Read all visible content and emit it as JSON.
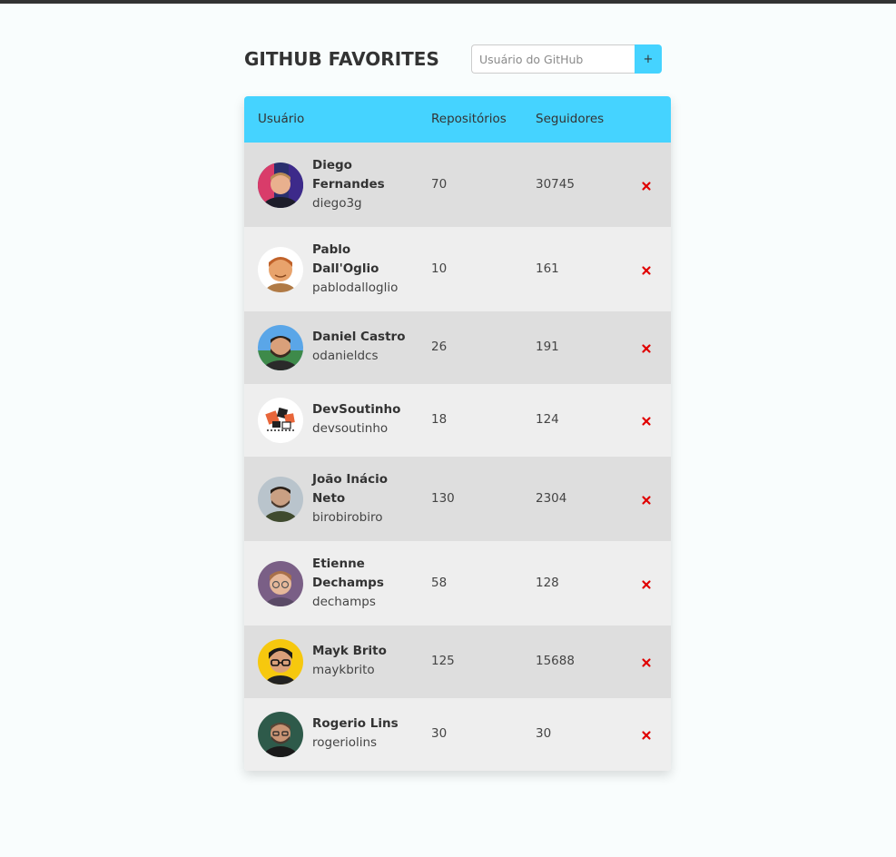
{
  "app": {
    "title": "GITHUB FAVORITES"
  },
  "search": {
    "placeholder": "Usuário do GitHub",
    "value": "",
    "add_label": "+"
  },
  "table": {
    "columns": {
      "user": "Usuário",
      "repos": "Repositórios",
      "followers": "Seguidores"
    },
    "rows": [
      {
        "name": "Diego Fernandes",
        "login": "diego3g",
        "repos": "70",
        "followers": "30745"
      },
      {
        "name": "Pablo Dall'Oglio",
        "login": "pablodalloglio",
        "repos": "10",
        "followers": "161"
      },
      {
        "name": "Daniel Castro",
        "login": "odanieldcs",
        "repos": "26",
        "followers": "191"
      },
      {
        "name": "DevSoutinho",
        "login": "devsoutinho",
        "repos": "18",
        "followers": "124"
      },
      {
        "name": "João Inácio Neto",
        "login": "birobirobiro",
        "repos": "130",
        "followers": "2304"
      },
      {
        "name": "Etienne Dechamps",
        "login": "dechamps",
        "repos": "58",
        "followers": "128"
      },
      {
        "name": "Mayk Brito",
        "login": "maykbrito",
        "repos": "125",
        "followers": "15688"
      },
      {
        "name": "Rogerio Lins",
        "login": "rogeriolins",
        "repos": "30",
        "followers": "30"
      }
    ]
  },
  "icons": {
    "add": "plus-icon",
    "remove": "close-icon",
    "avatar": "user-avatar"
  },
  "colors": {
    "accent": "#45d3ff",
    "remove": "#e00000",
    "row_dark": "#dedede",
    "row_light": "#eeeeee",
    "top_bar": "#333333"
  }
}
